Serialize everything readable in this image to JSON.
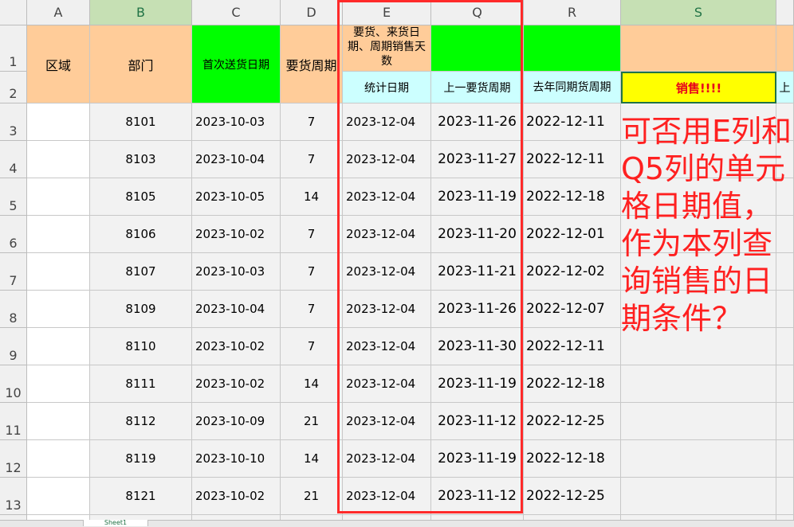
{
  "columns": [
    "A",
    "B",
    "C",
    "D",
    "E",
    "Q",
    "R",
    "S"
  ],
  "row_numbers": [
    "1",
    "2",
    "3",
    "4",
    "5",
    "6",
    "7",
    "8",
    "9",
    "10",
    "11",
    "12",
    "13"
  ],
  "headers": {
    "region": "区域",
    "department": "部门",
    "first_delivery_date": "首次送货日期",
    "order_cycle": "要货周期",
    "e_top": "要货、来货日期、周期销售天数",
    "stat_date": "统计日期",
    "prev_order_cycle": "上一要货周期",
    "last_year_cycle": "去年同期货周期",
    "sales": "销售!!!!",
    "s_next": "上"
  },
  "rows": [
    {
      "dept": "8101",
      "first": "2023-10-03",
      "cycle": "7",
      "stat": "2023-12-04",
      "prev": "2023-11-26",
      "ly": "2022-12-11"
    },
    {
      "dept": "8103",
      "first": "2023-10-04",
      "cycle": "7",
      "stat": "2023-12-04",
      "prev": "2023-11-27",
      "ly": "2022-12-11"
    },
    {
      "dept": "8105",
      "first": "2023-10-05",
      "cycle": "14",
      "stat": "2023-12-04",
      "prev": "2023-11-19",
      "ly": "2022-12-18"
    },
    {
      "dept": "8106",
      "first": "2023-10-02",
      "cycle": "7",
      "stat": "2023-12-04",
      "prev": "2023-11-20",
      "ly": "2022-12-01"
    },
    {
      "dept": "8107",
      "first": "2023-10-03",
      "cycle": "7",
      "stat": "2023-12-04",
      "prev": "2023-11-21",
      "ly": "2022-12-02"
    },
    {
      "dept": "8109",
      "first": "2023-10-04",
      "cycle": "7",
      "stat": "2023-12-04",
      "prev": "2023-11-26",
      "ly": "2022-12-07"
    },
    {
      "dept": "8110",
      "first": "2023-10-02",
      "cycle": "7",
      "stat": "2023-12-04",
      "prev": "2023-11-30",
      "ly": "2022-12-11"
    },
    {
      "dept": "8111",
      "first": "2023-10-02",
      "cycle": "14",
      "stat": "2023-12-04",
      "prev": "2023-11-19",
      "ly": "2022-12-18"
    },
    {
      "dept": "8112",
      "first": "2023-10-09",
      "cycle": "21",
      "stat": "2023-12-04",
      "prev": "2023-11-12",
      "ly": "2022-12-25"
    },
    {
      "dept": "8119",
      "first": "2023-10-10",
      "cycle": "14",
      "stat": "2023-12-04",
      "prev": "2023-11-19",
      "ly": "2022-12-18"
    },
    {
      "dept": "8121",
      "first": "2023-10-02",
      "cycle": "21",
      "stat": "2023-12-04",
      "prev": "2023-11-12",
      "ly": "2022-12-25"
    }
  ],
  "annotation": "可否用E列和Q5列的单元格日期值，作为本列查询销售的日期条件？",
  "sheet_tab": "Sheet1",
  "colors": {
    "peach": "#ffcc99",
    "green": "#00ff00",
    "cyan": "#ccffff",
    "yellow": "#ffff00",
    "annotation_red": "#ff2020"
  }
}
